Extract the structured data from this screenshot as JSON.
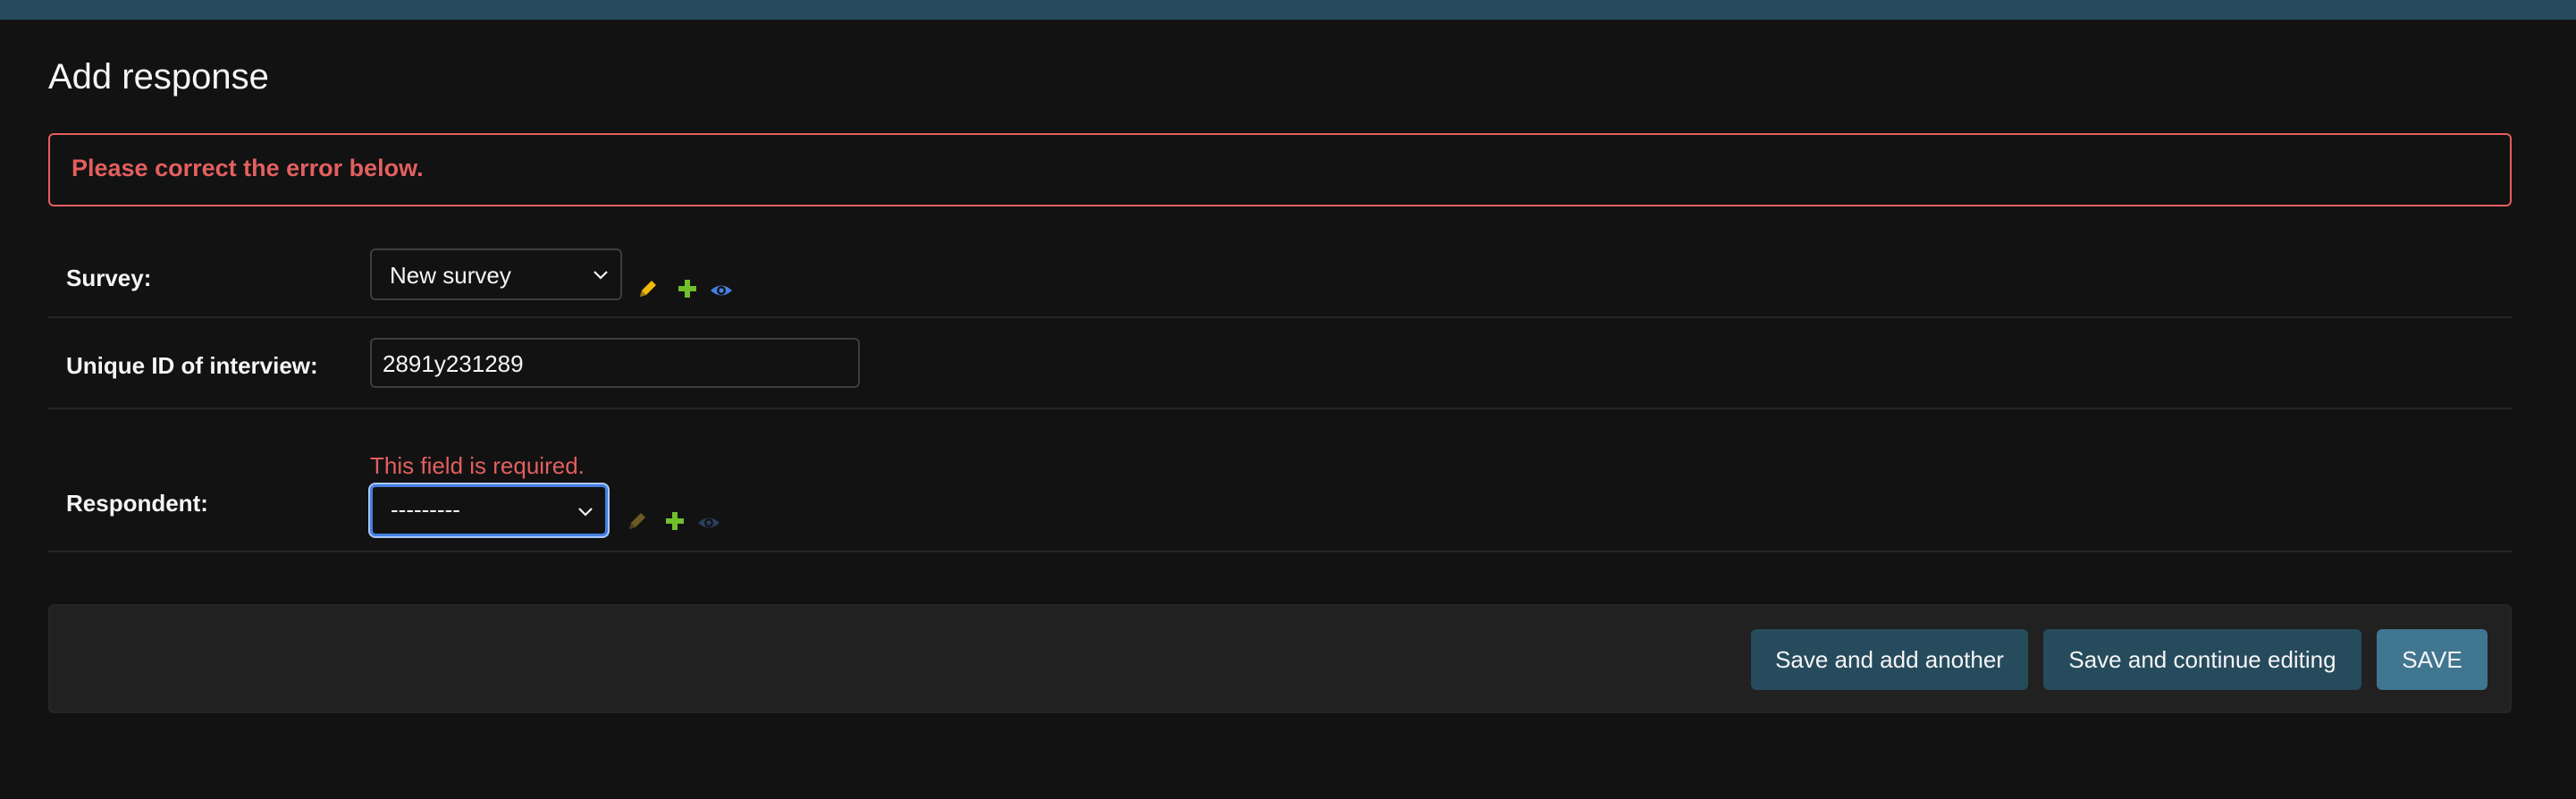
{
  "page": {
    "title": "Add response"
  },
  "errornote": "Please correct the error below.",
  "fields": {
    "survey": {
      "label": "Survey:",
      "value": "New survey"
    },
    "interview_id": {
      "label": "Unique ID of interview:",
      "value": "2891y231289"
    },
    "respondent": {
      "label": "Respondent:",
      "value": "---------",
      "error": "This field is required."
    }
  },
  "actions": {
    "save_add_another": "Save and add another",
    "save_continue": "Save and continue editing",
    "save": "SAVE"
  },
  "colors": {
    "header": "#264b5d",
    "background": "#121212",
    "error": "#e35f5f",
    "button": "#264b5d",
    "primary_button": "#417690",
    "edit_icon": "#efb80b",
    "add_icon": "#70bf2b",
    "view_icon": "#447fe0",
    "focus": "#447fe0"
  },
  "icons": [
    "pencil-icon",
    "plus-icon",
    "eye-icon",
    "chevron-down-icon"
  ]
}
